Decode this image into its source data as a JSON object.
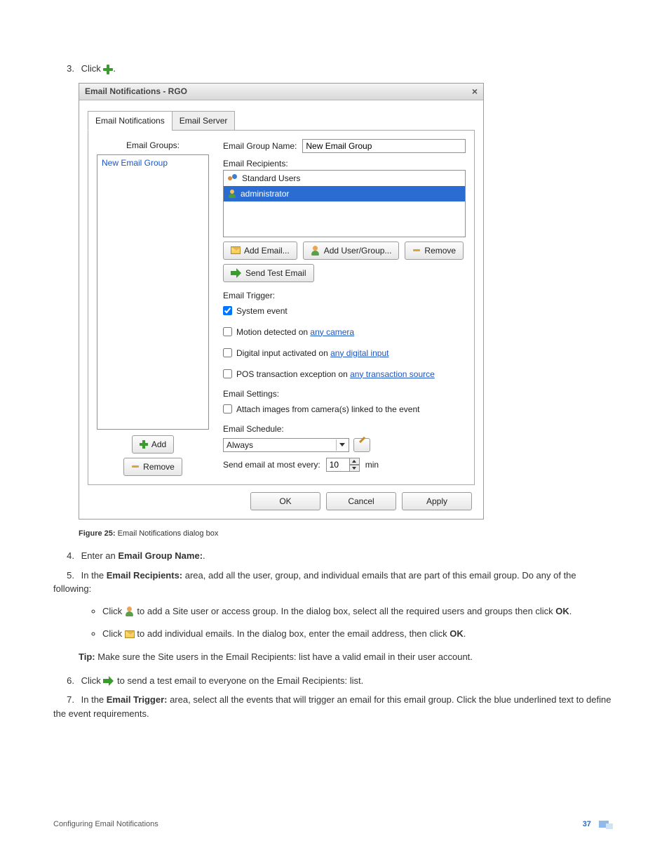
{
  "steps": {
    "s3_prefix": "Click",
    "s3_suffix": ".",
    "s4_prefix": "Enter an ",
    "s4_bold": "Email Group Name:",
    "s4_suffix": ".",
    "s5_prefix": "In the ",
    "s5_bold": "Email Recipients:",
    "s5_mid": " area, add all the user, group, and individual emails that are part of this email group. Do any of the following:",
    "s5_b1_a": "Click ",
    "s5_b1_b": " to add a Site user or access group. In the dialog box, select all the required users and groups then click ",
    "s5_b1_ok": "OK",
    "s5_b1_c": ".",
    "s5_b2_a": "Click ",
    "s5_b2_b": " to add individual emails. In the dialog box, enter the email address, then click ",
    "s5_b2_ok": "OK",
    "s5_b2_c": ".",
    "tip_label": "Tip:",
    "tip_text": " Make sure the Site users in the Email Recipients: list have a valid email in their user account.",
    "s6_a": "Click ",
    "s6_b": " to send a test email to everyone on the Email Recipients: list.",
    "s7_a": "In the ",
    "s7_bold": "Email Trigger:",
    "s7_b": " area, select all the events that will trigger an email for this email group. Click the blue underlined text to define the event requirements."
  },
  "figure": {
    "label": "Figure 25:",
    "caption": " Email Notifications dialog box"
  },
  "dialog": {
    "title": "Email Notifications - RGO",
    "tabs": {
      "notifications": "Email Notifications",
      "server": "Email Server"
    },
    "left": {
      "groups_label": "Email Groups:",
      "group_item": "New Email Group",
      "add": "Add",
      "remove": "Remove"
    },
    "right": {
      "group_name_label": "Email Group Name:",
      "group_name_value": "New Email Group",
      "recipients_label": "Email Recipients:",
      "recipient_std": "Standard Users",
      "recipient_admin": "administrator",
      "btn_add_email": "Add Email...",
      "btn_add_user": "Add User/Group...",
      "btn_remove": "Remove",
      "btn_send_test": "Send Test Email",
      "trigger_label": "Email Trigger:",
      "trg_system": "System event",
      "trg_motion_a": "Motion detected on ",
      "trg_motion_link": "any camera",
      "trg_digital_a": "Digital input activated on ",
      "trg_digital_link": "any digital input",
      "trg_pos_a": "POS transaction exception on ",
      "trg_pos_link": "any transaction source",
      "settings_label": "Email Settings:",
      "attach_label": "Attach images from camera(s) linked to the event",
      "schedule_label": "Email Schedule:",
      "schedule_value": "Always",
      "send_every_label": "Send email at most every:",
      "send_every_value": "10",
      "send_every_unit": "min"
    },
    "footer": {
      "ok": "OK",
      "cancel": "Cancel",
      "apply": "Apply"
    }
  },
  "footer": {
    "section": "Configuring Email Notifications",
    "page": "37"
  }
}
